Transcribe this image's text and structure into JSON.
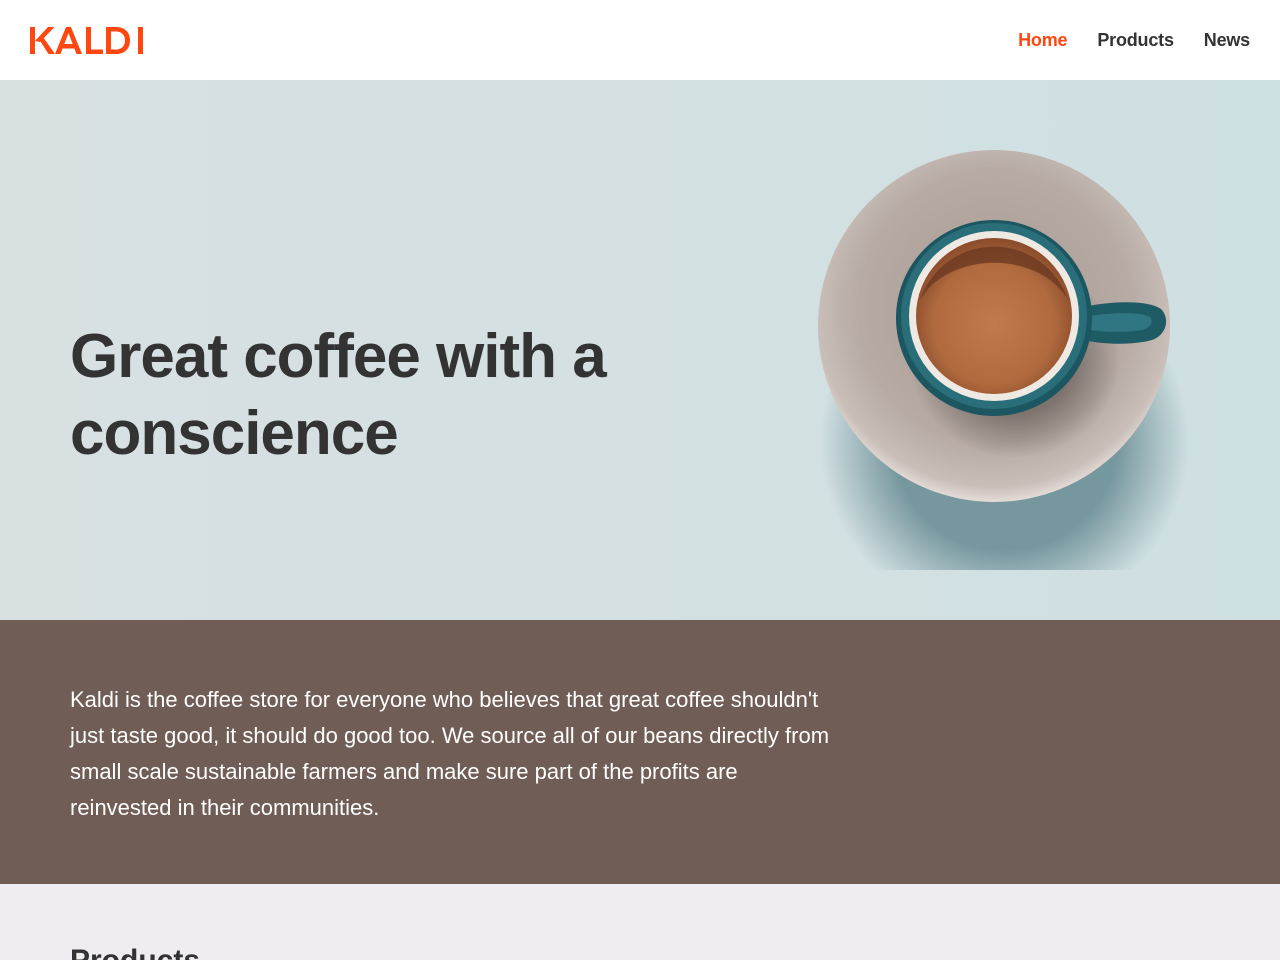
{
  "brand": {
    "name": "KALDI",
    "color": "#ff470f"
  },
  "nav": {
    "items": [
      {
        "label": "Home",
        "active": true
      },
      {
        "label": "Products",
        "active": false
      },
      {
        "label": "News",
        "active": false
      }
    ]
  },
  "hero": {
    "title": "Great coffee with a conscience",
    "image": "coffee-cup-on-saucer"
  },
  "intro": {
    "text": "Kaldi is the coffee store for everyone who believes that great coffee shouldn't just taste good, it should do good too. We source all of our beans directly from small scale sustainable farmers and make sure part of the profits are reinvested in their communities."
  },
  "products": {
    "title": "Products"
  },
  "colors": {
    "accent": "#ff470f",
    "text": "#333333",
    "intro_bg": "#705d55",
    "products_bg": "#efedf2"
  }
}
